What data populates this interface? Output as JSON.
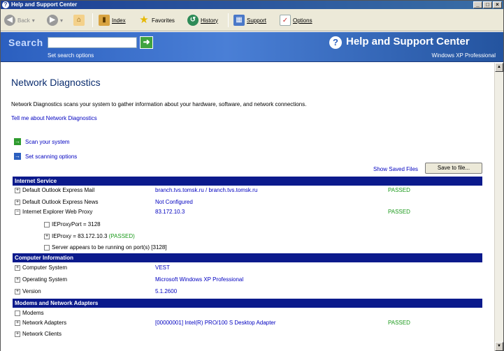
{
  "window": {
    "title": "Help and Support Center",
    "controls": [
      "_",
      "□",
      "×"
    ]
  },
  "toolbar": {
    "back": "Back",
    "index": "Index",
    "favorites": "Favorites",
    "history": "History",
    "support": "Support",
    "options": "Options"
  },
  "search": {
    "label": "Search",
    "value": "",
    "options_link": "Set search options"
  },
  "header": {
    "app_title": "Help and Support Center",
    "app_subtitle": "Windows XP Professional"
  },
  "page": {
    "title": "Network Diagnostics",
    "description": "Network Diagnostics scans your system to gather information about your hardware, software, and network connections.",
    "tell_me": "Tell me about Network Diagnostics",
    "scan": "Scan your system",
    "set_options": "Set scanning options",
    "show_saved": "Show Saved Files",
    "save_button": "Save to file..."
  },
  "sections": {
    "internet": {
      "header": "Internet Service",
      "rows": [
        {
          "label": "Default Outlook Express Mail",
          "value": "branch.tvs.tomsk.ru / branch.tvs.tomsk.ru",
          "status": "PASSED"
        },
        {
          "label": "Default Outlook Express News",
          "value": "Not Configured",
          "status": ""
        },
        {
          "label": "Internet Explorer Web Proxy",
          "value": "83.172.10.3",
          "status": "PASSED"
        }
      ],
      "proxy_children": {
        "port": "IEProxyPort = 3128",
        "proxy": "IEProxy = 83.172.10.3",
        "proxy_status": "(PASSED)",
        "server": "Server appears to be running on port(s) [3128]"
      }
    },
    "computer": {
      "header": "Computer Information",
      "rows": [
        {
          "label": "Computer System",
          "value": "VEST"
        },
        {
          "label": "Operating System",
          "value": "Microsoft Windows XP Professional"
        },
        {
          "label": "Version",
          "value": "5.1.2600"
        }
      ]
    },
    "modems": {
      "header": "Modems and Network Adapters",
      "rows": [
        {
          "label": "Modems",
          "value": "",
          "status": ""
        },
        {
          "label": "Network Adapters",
          "value": "[00000001] Intel(R) PRO/100 S Desktop Adapter",
          "status": "PASSED"
        },
        {
          "label": "Network Clients",
          "value": "",
          "status": ""
        }
      ]
    }
  },
  "colors": {
    "section_bg": "#0b1a8c",
    "link": "#0000c0",
    "passed": "#1a9a1a",
    "band": "#3a6bc9"
  }
}
